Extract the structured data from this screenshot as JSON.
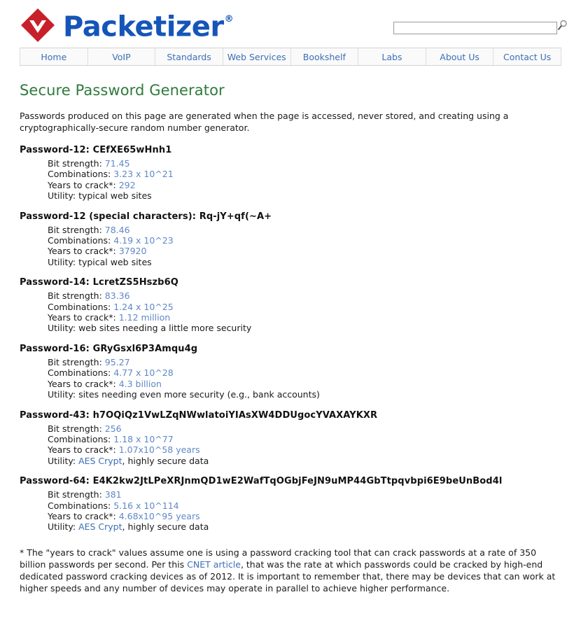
{
  "brand": {
    "name": "Packetizer",
    "registered_mark": "®",
    "logo_icon": "red-diamond-logo",
    "logo_color": "#c8202a",
    "wordmark_color": "#1555b8"
  },
  "search": {
    "value": "",
    "placeholder": "",
    "icon": "search-icon"
  },
  "nav": {
    "items": [
      {
        "label": "Home"
      },
      {
        "label": "VoIP"
      },
      {
        "label": "Standards"
      },
      {
        "label": "Web Services"
      },
      {
        "label": "Bookshelf"
      },
      {
        "label": "Labs"
      },
      {
        "label": "About Us"
      },
      {
        "label": "Contact Us"
      }
    ]
  },
  "main": {
    "title": "Secure Password Generator",
    "title_color": "#2f7a3d",
    "intro": "Passwords produced on this page are generated when the page is accessed, never stored, and creating using a cryptographically-secure random number generator.",
    "labels": {
      "bit_strength": "Bit strength:",
      "combinations": "Combinations:",
      "years_to_crack": "Years to crack*:",
      "utility": "Utility:"
    },
    "passwords": [
      {
        "heading_label": "Password-12:",
        "password": "CEfXE65wHnh1",
        "bit_strength": "71.45",
        "combinations": "3.23 x 10^21",
        "years_to_crack": "292",
        "utility_text": "typical web sites",
        "utility_link": "",
        "utility_suffix": ""
      },
      {
        "heading_label": "Password-12 (special characters):",
        "password": "Rq-jY+qf(~A+",
        "bit_strength": "78.46",
        "combinations": "4.19 x 10^23",
        "years_to_crack": "37920",
        "utility_text": "typical web sites",
        "utility_link": "",
        "utility_suffix": ""
      },
      {
        "heading_label": "Password-14:",
        "password": "LcretZS5Hszb6Q",
        "bit_strength": "83.36",
        "combinations": "1.24 x 10^25",
        "years_to_crack": "1.12 million",
        "utility_text": "web sites needing a little more security",
        "utility_link": "",
        "utility_suffix": ""
      },
      {
        "heading_label": "Password-16:",
        "password": "GRyGsxl6P3Amqu4g",
        "bit_strength": "95.27",
        "combinations": "4.77 x 10^28",
        "years_to_crack": "4.3 billion",
        "utility_text": "sites needing even more security (e.g., bank accounts)",
        "utility_link": "",
        "utility_suffix": ""
      },
      {
        "heading_label": "Password-43:",
        "password": "h7OQiQz1VwLZqNWwlatoiYIAsXW4DDUgocYVAXAYKXR",
        "bit_strength": "256",
        "combinations": "1.18 x 10^77",
        "years_to_crack": "1.07x10^58 years",
        "utility_text": "",
        "utility_link": "AES Crypt",
        "utility_suffix": ", highly secure data"
      },
      {
        "heading_label": "Password-64:",
        "password": "E4K2kw2JtLPeXRJnmQD1wE2WafTqOGbjFeJN9uMP44GbTtpqvbpi6E9beUnBod4l",
        "bit_strength": "381",
        "combinations": "5.16 x 10^114",
        "years_to_crack": "4.68x10^95 years",
        "utility_text": "",
        "utility_link": "AES Crypt",
        "utility_suffix": ", highly secure data"
      }
    ],
    "footnote": {
      "part1": "* The \"years to crack\" values assume one is using a password cracking tool that can crack passwords at a rate of 350 billion passwords per second. Per this ",
      "link": "CNET article",
      "part2": ", that was the rate at which passwords could be cracked by high-end dedicated password cracking devices as of 2012. It is important to remember that, there may be devices that can work at higher speeds and any number of devices may operate in parallel to achieve higher performance."
    }
  }
}
